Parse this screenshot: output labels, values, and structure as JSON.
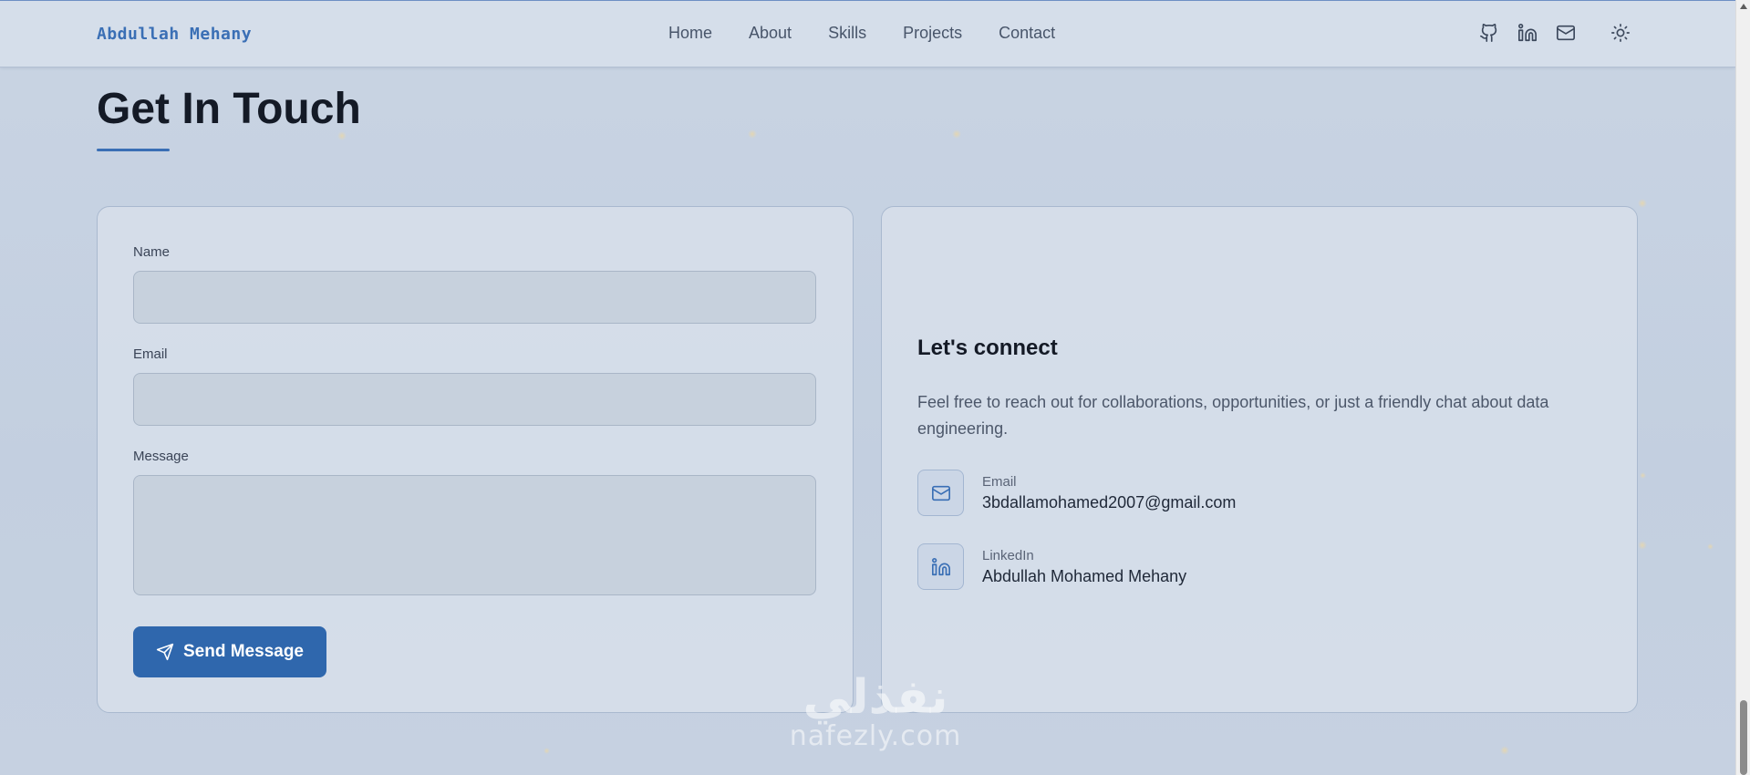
{
  "nav": {
    "brand": "Abdullah Mehany",
    "links": [
      "Home",
      "About",
      "Skills",
      "Projects",
      "Contact"
    ],
    "icons": [
      "github-icon",
      "linkedin-icon",
      "mail-icon",
      "sun-icon"
    ]
  },
  "section": {
    "title": "Get In Touch"
  },
  "form": {
    "name_label": "Name",
    "name_value": "",
    "email_label": "Email",
    "email_value": "",
    "message_label": "Message",
    "message_value": "",
    "submit_label": "Send Message",
    "submit_icon": "send-icon"
  },
  "info": {
    "title": "Let's connect",
    "text": "Feel free to reach out for collaborations, opportunities, or just a friendly chat about data engineering.",
    "contacts": [
      {
        "label": "Email",
        "value": "3bdallamohamed2007@gmail.com",
        "icon": "mail-icon"
      },
      {
        "label": "LinkedIn",
        "value": "Abdullah Mohamed Mehany",
        "icon": "linkedin-icon"
      }
    ]
  },
  "watermark": {
    "arabic": "نفذلي",
    "latin": "nafezly.com"
  },
  "colors": {
    "accent": "#3a6fb5",
    "button": "#2f67ad",
    "background": "#c6d1e1",
    "card": "#d7dfea"
  }
}
